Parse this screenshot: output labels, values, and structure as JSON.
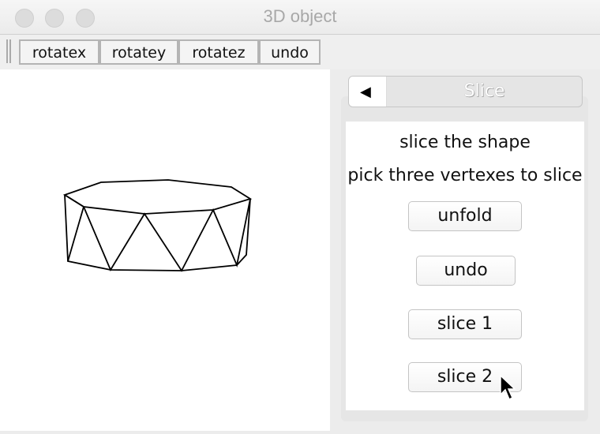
{
  "window": {
    "title": "3D object"
  },
  "toolbar": {
    "buttons": [
      "rotatex",
      "rotatey",
      "rotatez",
      "undo"
    ]
  },
  "panel": {
    "tab_title": "Slice",
    "back_icon": "◀",
    "line1": "slice the shape",
    "line2": "pick three vertexes to slice",
    "buttons": [
      "unfold",
      "undo",
      "slice 1",
      "slice 2"
    ]
  }
}
